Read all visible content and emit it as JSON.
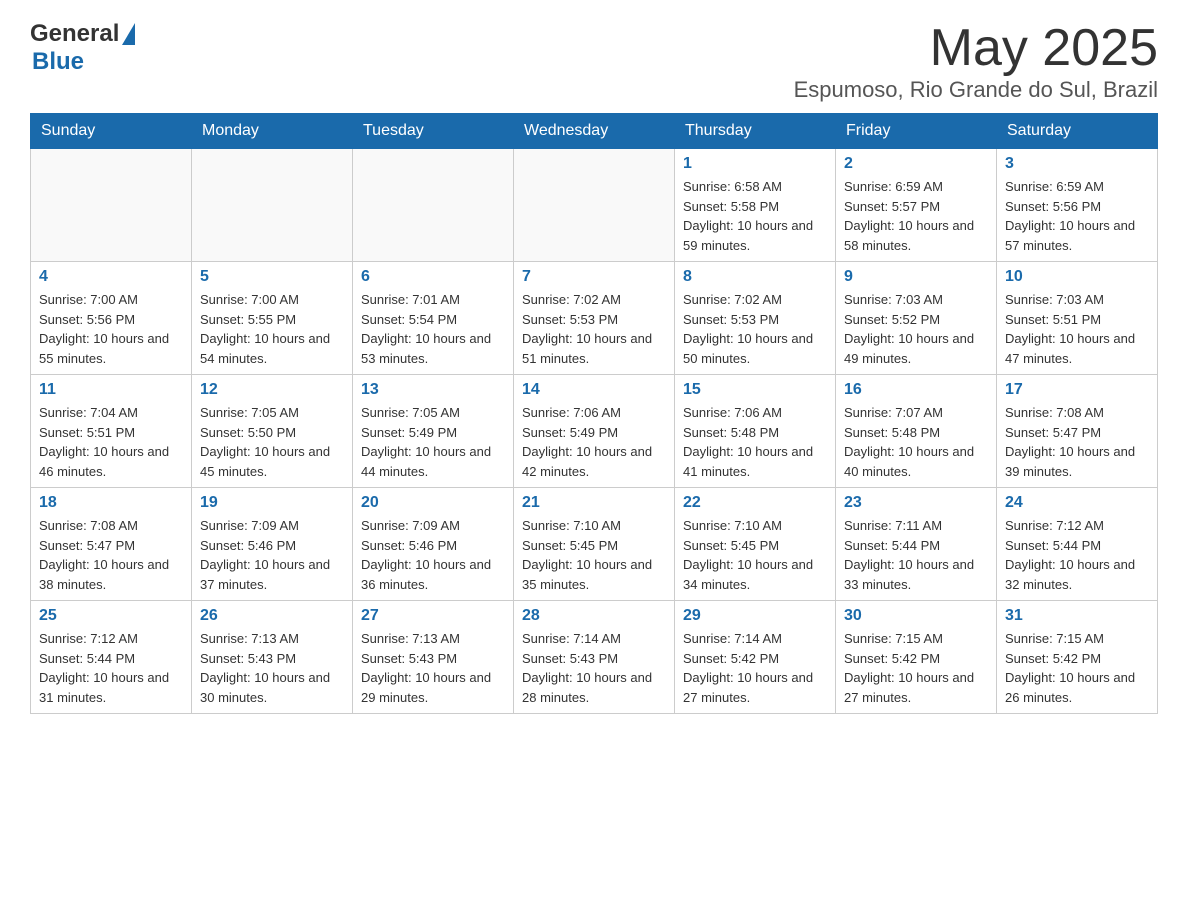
{
  "header": {
    "logo": {
      "general": "General",
      "blue": "Blue",
      "triangle": "▲"
    },
    "month": "May 2025",
    "location": "Espumoso, Rio Grande do Sul, Brazil"
  },
  "days_of_week": [
    "Sunday",
    "Monday",
    "Tuesday",
    "Wednesday",
    "Thursday",
    "Friday",
    "Saturday"
  ],
  "weeks": [
    [
      {
        "day": "",
        "sunrise": "",
        "sunset": "",
        "daylight": ""
      },
      {
        "day": "",
        "sunrise": "",
        "sunset": "",
        "daylight": ""
      },
      {
        "day": "",
        "sunrise": "",
        "sunset": "",
        "daylight": ""
      },
      {
        "day": "",
        "sunrise": "",
        "sunset": "",
        "daylight": ""
      },
      {
        "day": "1",
        "sunrise": "Sunrise: 6:58 AM",
        "sunset": "Sunset: 5:58 PM",
        "daylight": "Daylight: 10 hours and 59 minutes."
      },
      {
        "day": "2",
        "sunrise": "Sunrise: 6:59 AM",
        "sunset": "Sunset: 5:57 PM",
        "daylight": "Daylight: 10 hours and 58 minutes."
      },
      {
        "day": "3",
        "sunrise": "Sunrise: 6:59 AM",
        "sunset": "Sunset: 5:56 PM",
        "daylight": "Daylight: 10 hours and 57 minutes."
      }
    ],
    [
      {
        "day": "4",
        "sunrise": "Sunrise: 7:00 AM",
        "sunset": "Sunset: 5:56 PM",
        "daylight": "Daylight: 10 hours and 55 minutes."
      },
      {
        "day": "5",
        "sunrise": "Sunrise: 7:00 AM",
        "sunset": "Sunset: 5:55 PM",
        "daylight": "Daylight: 10 hours and 54 minutes."
      },
      {
        "day": "6",
        "sunrise": "Sunrise: 7:01 AM",
        "sunset": "Sunset: 5:54 PM",
        "daylight": "Daylight: 10 hours and 53 minutes."
      },
      {
        "day": "7",
        "sunrise": "Sunrise: 7:02 AM",
        "sunset": "Sunset: 5:53 PM",
        "daylight": "Daylight: 10 hours and 51 minutes."
      },
      {
        "day": "8",
        "sunrise": "Sunrise: 7:02 AM",
        "sunset": "Sunset: 5:53 PM",
        "daylight": "Daylight: 10 hours and 50 minutes."
      },
      {
        "day": "9",
        "sunrise": "Sunrise: 7:03 AM",
        "sunset": "Sunset: 5:52 PM",
        "daylight": "Daylight: 10 hours and 49 minutes."
      },
      {
        "day": "10",
        "sunrise": "Sunrise: 7:03 AM",
        "sunset": "Sunset: 5:51 PM",
        "daylight": "Daylight: 10 hours and 47 minutes."
      }
    ],
    [
      {
        "day": "11",
        "sunrise": "Sunrise: 7:04 AM",
        "sunset": "Sunset: 5:51 PM",
        "daylight": "Daylight: 10 hours and 46 minutes."
      },
      {
        "day": "12",
        "sunrise": "Sunrise: 7:05 AM",
        "sunset": "Sunset: 5:50 PM",
        "daylight": "Daylight: 10 hours and 45 minutes."
      },
      {
        "day": "13",
        "sunrise": "Sunrise: 7:05 AM",
        "sunset": "Sunset: 5:49 PM",
        "daylight": "Daylight: 10 hours and 44 minutes."
      },
      {
        "day": "14",
        "sunrise": "Sunrise: 7:06 AM",
        "sunset": "Sunset: 5:49 PM",
        "daylight": "Daylight: 10 hours and 42 minutes."
      },
      {
        "day": "15",
        "sunrise": "Sunrise: 7:06 AM",
        "sunset": "Sunset: 5:48 PM",
        "daylight": "Daylight: 10 hours and 41 minutes."
      },
      {
        "day": "16",
        "sunrise": "Sunrise: 7:07 AM",
        "sunset": "Sunset: 5:48 PM",
        "daylight": "Daylight: 10 hours and 40 minutes."
      },
      {
        "day": "17",
        "sunrise": "Sunrise: 7:08 AM",
        "sunset": "Sunset: 5:47 PM",
        "daylight": "Daylight: 10 hours and 39 minutes."
      }
    ],
    [
      {
        "day": "18",
        "sunrise": "Sunrise: 7:08 AM",
        "sunset": "Sunset: 5:47 PM",
        "daylight": "Daylight: 10 hours and 38 minutes."
      },
      {
        "day": "19",
        "sunrise": "Sunrise: 7:09 AM",
        "sunset": "Sunset: 5:46 PM",
        "daylight": "Daylight: 10 hours and 37 minutes."
      },
      {
        "day": "20",
        "sunrise": "Sunrise: 7:09 AM",
        "sunset": "Sunset: 5:46 PM",
        "daylight": "Daylight: 10 hours and 36 minutes."
      },
      {
        "day": "21",
        "sunrise": "Sunrise: 7:10 AM",
        "sunset": "Sunset: 5:45 PM",
        "daylight": "Daylight: 10 hours and 35 minutes."
      },
      {
        "day": "22",
        "sunrise": "Sunrise: 7:10 AM",
        "sunset": "Sunset: 5:45 PM",
        "daylight": "Daylight: 10 hours and 34 minutes."
      },
      {
        "day": "23",
        "sunrise": "Sunrise: 7:11 AM",
        "sunset": "Sunset: 5:44 PM",
        "daylight": "Daylight: 10 hours and 33 minutes."
      },
      {
        "day": "24",
        "sunrise": "Sunrise: 7:12 AM",
        "sunset": "Sunset: 5:44 PM",
        "daylight": "Daylight: 10 hours and 32 minutes."
      }
    ],
    [
      {
        "day": "25",
        "sunrise": "Sunrise: 7:12 AM",
        "sunset": "Sunset: 5:44 PM",
        "daylight": "Daylight: 10 hours and 31 minutes."
      },
      {
        "day": "26",
        "sunrise": "Sunrise: 7:13 AM",
        "sunset": "Sunset: 5:43 PM",
        "daylight": "Daylight: 10 hours and 30 minutes."
      },
      {
        "day": "27",
        "sunrise": "Sunrise: 7:13 AM",
        "sunset": "Sunset: 5:43 PM",
        "daylight": "Daylight: 10 hours and 29 minutes."
      },
      {
        "day": "28",
        "sunrise": "Sunrise: 7:14 AM",
        "sunset": "Sunset: 5:43 PM",
        "daylight": "Daylight: 10 hours and 28 minutes."
      },
      {
        "day": "29",
        "sunrise": "Sunrise: 7:14 AM",
        "sunset": "Sunset: 5:42 PM",
        "daylight": "Daylight: 10 hours and 27 minutes."
      },
      {
        "day": "30",
        "sunrise": "Sunrise: 7:15 AM",
        "sunset": "Sunset: 5:42 PM",
        "daylight": "Daylight: 10 hours and 27 minutes."
      },
      {
        "day": "31",
        "sunrise": "Sunrise: 7:15 AM",
        "sunset": "Sunset: 5:42 PM",
        "daylight": "Daylight: 10 hours and 26 minutes."
      }
    ]
  ]
}
